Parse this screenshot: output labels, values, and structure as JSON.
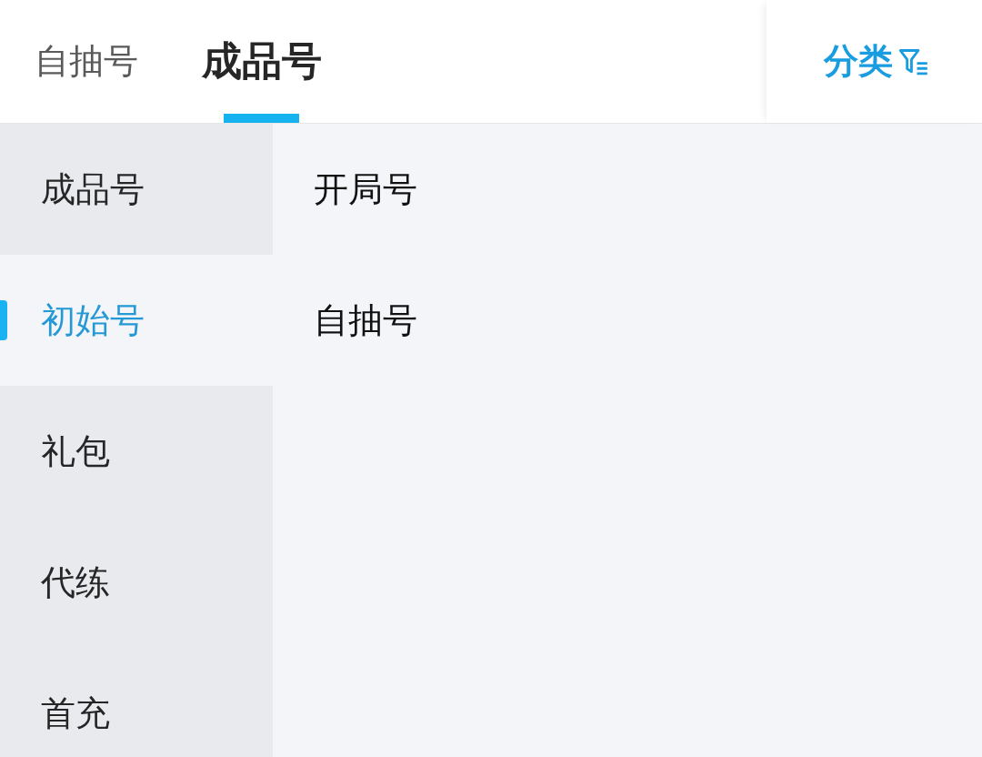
{
  "tabs": [
    {
      "label": "自抽号",
      "selected": false
    },
    {
      "label": "成品号",
      "selected": true
    }
  ],
  "filter_button": {
    "label": "分类"
  },
  "sidebar": {
    "items": [
      {
        "label": "成品号",
        "selected": false
      },
      {
        "label": "初始号",
        "selected": true
      },
      {
        "label": "礼包",
        "selected": false
      },
      {
        "label": "代练",
        "selected": false
      },
      {
        "label": "首充",
        "selected": false
      }
    ]
  },
  "content": {
    "items": [
      {
        "label": "开局号"
      },
      {
        "label": "自抽号"
      }
    ]
  }
}
